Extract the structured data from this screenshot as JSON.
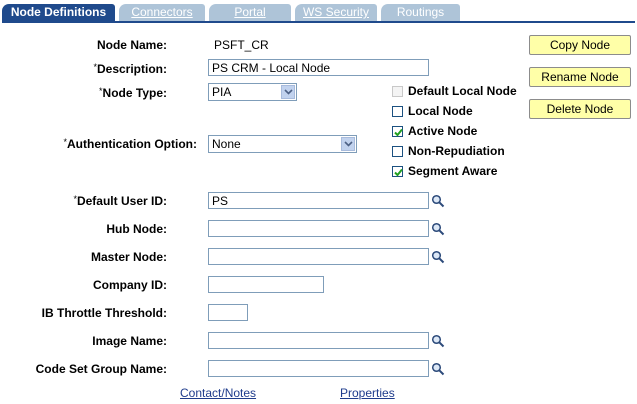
{
  "tabs": [
    {
      "label": "Node Definitions",
      "active": true
    },
    {
      "label": "Connectors",
      "active": false
    },
    {
      "label": "Portal",
      "active": false
    },
    {
      "label": "WS Security",
      "active": false
    },
    {
      "label": "Routings",
      "active": false
    }
  ],
  "form": {
    "node_name_label": "Node Name:",
    "node_name_value": "PSFT_CR",
    "required_mark": "*",
    "description_label": "Description:",
    "description_value": "PS CRM - Local Node",
    "node_type_label": "Node Type:",
    "node_type_value": "PIA",
    "auth_label": "Authentication Option:",
    "auth_value": "None",
    "default_user_label": "Default User ID:",
    "default_user_value": "PS",
    "hub_node_label": "Hub Node:",
    "hub_node_value": "",
    "master_node_label": "Master Node:",
    "master_node_value": "",
    "company_id_label": "Company ID:",
    "company_id_value": "",
    "throttle_label": "IB Throttle Threshold:",
    "throttle_value": "",
    "image_name_label": "Image Name:",
    "image_name_value": "",
    "code_set_label": "Code Set Group Name:",
    "code_set_value": ""
  },
  "checkboxes": [
    {
      "label": "Default Local Node",
      "checked": false,
      "disabled": true
    },
    {
      "label": "Local Node",
      "checked": false,
      "disabled": false
    },
    {
      "label": "Active Node",
      "checked": true,
      "disabled": false
    },
    {
      "label": "Non-Repudiation",
      "checked": false,
      "disabled": false
    },
    {
      "label": "Segment Aware",
      "checked": true,
      "disabled": false
    }
  ],
  "buttons": {
    "copy": "Copy Node",
    "rename": "Rename Node",
    "delete": "Delete Node"
  },
  "links": {
    "contact_notes": "Contact/Notes",
    "properties": "Properties"
  },
  "icons": {
    "lookup": "magnifier-icon",
    "dropdown": "chevron-down-icon",
    "check": "check-icon"
  },
  "colors": {
    "tab_active": "#1f4a8c",
    "tab_inactive": "#aec4d8",
    "button_bg": "#ffffa8",
    "link": "#1f3c8c"
  }
}
